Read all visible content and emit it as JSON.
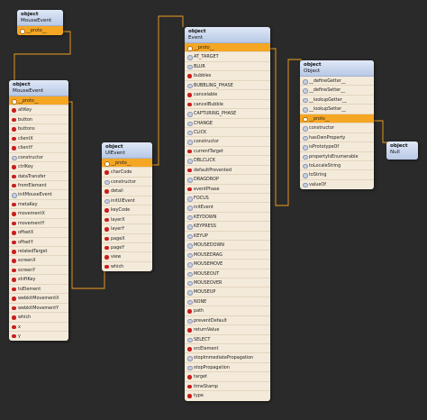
{
  "colors": {
    "background": "#2a2a2a",
    "header": "#c9d7ee",
    "row": "#f4ead9",
    "proto_row": "#f5a623",
    "edge": "#f0a020",
    "method_dot": "#c81e1e",
    "constant_dot": "#c6cfe0"
  },
  "nodes": {
    "mouseevent_proto": {
      "kind": "object",
      "name": "MouseEvent",
      "rows": [
        {
          "label": "__proto__",
          "type": "proto"
        }
      ]
    },
    "mouseevent": {
      "kind": "object",
      "name": "MouseEvent",
      "rows": [
        {
          "label": "__proto__",
          "type": "proto"
        },
        {
          "label": "altKey",
          "type": "method"
        },
        {
          "label": "button",
          "type": "method"
        },
        {
          "label": "buttons",
          "type": "method"
        },
        {
          "label": "clientX",
          "type": "method"
        },
        {
          "label": "clientY",
          "type": "method"
        },
        {
          "label": "constructor",
          "type": "constant"
        },
        {
          "label": "ctrlKey",
          "type": "method"
        },
        {
          "label": "dataTransfer",
          "type": "method"
        },
        {
          "label": "fromElement",
          "type": "method"
        },
        {
          "label": "initMouseEvent",
          "type": "constant"
        },
        {
          "label": "metaKey",
          "type": "method"
        },
        {
          "label": "movementX",
          "type": "method"
        },
        {
          "label": "movementY",
          "type": "method"
        },
        {
          "label": "offsetX",
          "type": "method"
        },
        {
          "label": "offsetY",
          "type": "method"
        },
        {
          "label": "relatedTarget",
          "type": "method"
        },
        {
          "label": "screenX",
          "type": "method"
        },
        {
          "label": "screenY",
          "type": "method"
        },
        {
          "label": "shiftKey",
          "type": "method"
        },
        {
          "label": "toElement",
          "type": "method"
        },
        {
          "label": "webkitMovementX",
          "type": "method"
        },
        {
          "label": "webkitMovementY",
          "type": "method"
        },
        {
          "label": "which",
          "type": "method"
        },
        {
          "label": "x",
          "type": "method"
        },
        {
          "label": "y",
          "type": "method"
        }
      ]
    },
    "uievent": {
      "kind": "object",
      "name": "UIEvent",
      "rows": [
        {
          "label": "__proto__",
          "type": "proto"
        },
        {
          "label": "charCode",
          "type": "method"
        },
        {
          "label": "constructor",
          "type": "constant"
        },
        {
          "label": "detail",
          "type": "method"
        },
        {
          "label": "initUIEvent",
          "type": "constant"
        },
        {
          "label": "keyCode",
          "type": "method"
        },
        {
          "label": "layerX",
          "type": "method"
        },
        {
          "label": "layerY",
          "type": "method"
        },
        {
          "label": "pageX",
          "type": "method"
        },
        {
          "label": "pageY",
          "type": "method"
        },
        {
          "label": "view",
          "type": "method"
        },
        {
          "label": "which",
          "type": "method"
        }
      ]
    },
    "event": {
      "kind": "object",
      "name": "Event",
      "rows": [
        {
          "label": "__proto__",
          "type": "proto"
        },
        {
          "label": "AT_TARGET",
          "type": "constant"
        },
        {
          "label": "BLUR",
          "type": "constant"
        },
        {
          "label": "bubbles",
          "type": "method"
        },
        {
          "label": "BUBBLING_PHASE",
          "type": "constant"
        },
        {
          "label": "cancelable",
          "type": "method"
        },
        {
          "label": "cancelBubble",
          "type": "method"
        },
        {
          "label": "CAPTURING_PHASE",
          "type": "constant"
        },
        {
          "label": "CHANGE",
          "type": "constant"
        },
        {
          "label": "CLICK",
          "type": "constant"
        },
        {
          "label": "constructor",
          "type": "constant"
        },
        {
          "label": "currentTarget",
          "type": "method"
        },
        {
          "label": "DBLCLICK",
          "type": "constant"
        },
        {
          "label": "defaultPrevented",
          "type": "method"
        },
        {
          "label": "DRAGDROP",
          "type": "constant"
        },
        {
          "label": "eventPhase",
          "type": "method"
        },
        {
          "label": "FOCUS",
          "type": "constant"
        },
        {
          "label": "initEvent",
          "type": "constant"
        },
        {
          "label": "KEYDOWN",
          "type": "constant"
        },
        {
          "label": "KEYPRESS",
          "type": "constant"
        },
        {
          "label": "KEYUP",
          "type": "constant"
        },
        {
          "label": "MOUSEDOWN",
          "type": "constant"
        },
        {
          "label": "MOUSEDRAG",
          "type": "constant"
        },
        {
          "label": "MOUSEMOVE",
          "type": "constant"
        },
        {
          "label": "MOUSEOUT",
          "type": "constant"
        },
        {
          "label": "MOUSEOVER",
          "type": "constant"
        },
        {
          "label": "MOUSEUP",
          "type": "constant"
        },
        {
          "label": "NONE",
          "type": "constant"
        },
        {
          "label": "path",
          "type": "method"
        },
        {
          "label": "preventDefault",
          "type": "constant"
        },
        {
          "label": "returnValue",
          "type": "method"
        },
        {
          "label": "SELECT",
          "type": "constant"
        },
        {
          "label": "srcElement",
          "type": "method"
        },
        {
          "label": "stopImmediatePropagation",
          "type": "constant"
        },
        {
          "label": "stopPropagation",
          "type": "constant"
        },
        {
          "label": "target",
          "type": "method"
        },
        {
          "label": "timeStamp",
          "type": "method"
        },
        {
          "label": "type",
          "type": "method"
        }
      ]
    },
    "object": {
      "kind": "object",
      "name": "Object",
      "rows": [
        {
          "label": "__defineGetter__",
          "type": "constant"
        },
        {
          "label": "__defineSetter__",
          "type": "constant"
        },
        {
          "label": "__lookupGetter__",
          "type": "constant"
        },
        {
          "label": "__lookupSetter__",
          "type": "constant"
        },
        {
          "label": "__proto__",
          "type": "proto"
        },
        {
          "label": "constructor",
          "type": "constant"
        },
        {
          "label": "hasOwnProperty",
          "type": "constant"
        },
        {
          "label": "isPrototypeOf",
          "type": "constant"
        },
        {
          "label": "propertyIsEnumerable",
          "type": "constant"
        },
        {
          "label": "toLocaleString",
          "type": "constant"
        },
        {
          "label": "toString",
          "type": "constant"
        },
        {
          "label": "valueOf",
          "type": "constant"
        }
      ]
    },
    "null": {
      "kind": "object",
      "name": "Null",
      "rows": []
    }
  }
}
